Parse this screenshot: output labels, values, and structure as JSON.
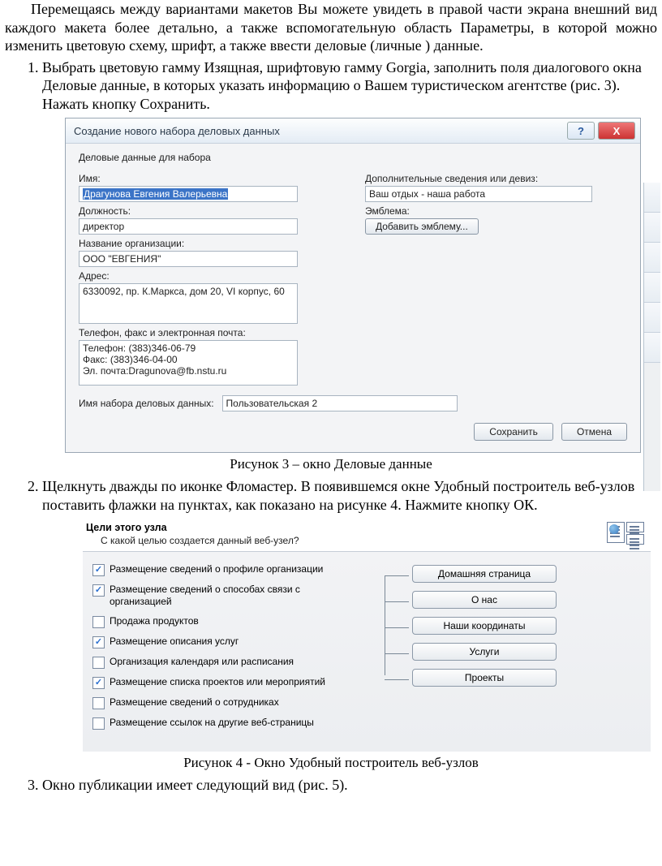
{
  "intro": "Перемещаясь между вариантами макетов Вы можете увидеть в правой части экрана внешний вид каждого макета более детально, а также вспомогательную область Параметры, в которой можно изменить цветовую схему, шрифт, а также ввести деловые (личные ) данные.",
  "list": {
    "i1": "Выбрать цветовую гамму Изящная, шрифтовую гамму Gorgia, заполнить поля диалогового окна Деловые данные, в которых указать информацию о Вашем туристическом агентстве (рис. 3). Нажать кнопку Сохранить.",
    "i2": "Щелкнуть дважды по иконке Фломастер. В появившемся окне Удобный построитель веб-узлов поставить флажки на пунктах, как показано на рисунке 4. Нажмите кнопку ОК.",
    "i3": "Окно публикации имеет следующий вид (рис. 5)."
  },
  "caption3": "Рисунок 3 – окно Деловые данные",
  "caption4": "Рисунок 4 - Окно Удобный построитель веб-узлов",
  "dlg1": {
    "title": "Создание нового набора деловых данных",
    "help": "?",
    "close": "X",
    "section": "Деловые данные для набора",
    "lbl_name": "Имя:",
    "val_name": "Драгунова Евгения Валерьевна",
    "lbl_extra": "Дополнительные сведения или девиз:",
    "val_extra": "Ваш отдых - наша работа",
    "lbl_job": "Должность:",
    "val_job": "директор",
    "lbl_emblem": "Эмблема:",
    "btn_emblem": "Добавить эмблему...",
    "lbl_org": "Название организации:",
    "val_org": "ООО \"ЕВГЕНИЯ\"",
    "lbl_addr": "Адрес:",
    "val_addr": "6330092, пр. К.Маркса, дом 20, VI корпус, 60",
    "lbl_contact": "Телефон, факс и электронная почта:",
    "val_contact": "Телефон: (383)346-06-79\nФакс: (383)346-04-00\nЭл. почта:Dragunova@fb.nstu.ru",
    "lbl_set": "Имя набора деловых данных:",
    "val_set": "Пользовательская 2",
    "btn_save": "Сохранить",
    "btn_cancel": "Отмена"
  },
  "dlg2": {
    "title": "Цели этого узла",
    "sub": "С какой целью создается данный веб-узел?",
    "checks": [
      {
        "label": "Размещение сведений о профиле организации",
        "on": true
      },
      {
        "label": "Размещение сведений о способах связи с организацией",
        "on": true
      },
      {
        "label": "Продажа продуктов",
        "on": false
      },
      {
        "label": "Размещение описания услуг",
        "on": true
      },
      {
        "label": "Организация календаря или расписания",
        "on": false
      },
      {
        "label": "Размещение списка проектов или мероприятий",
        "on": true
      },
      {
        "label": "Размещение сведений о сотрудниках",
        "on": false
      },
      {
        "label": "Размещение ссылок на другие веб-страницы",
        "on": false
      }
    ],
    "nodes": [
      "Домашняя страница",
      "О нас",
      "Наши координаты",
      "Услуги",
      "Проекты"
    ]
  }
}
